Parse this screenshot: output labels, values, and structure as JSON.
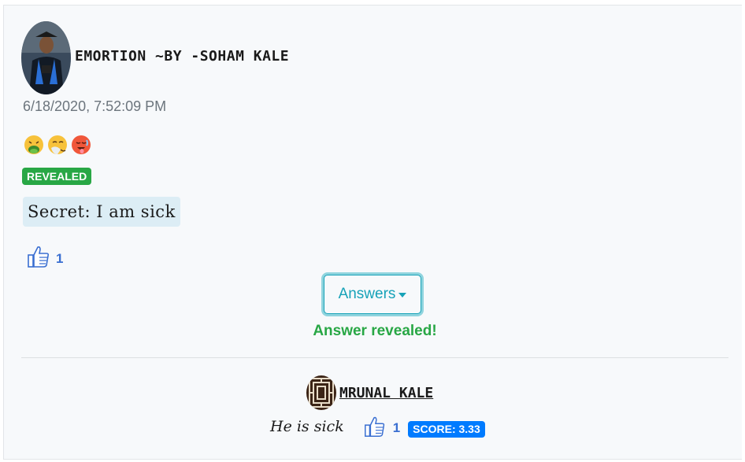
{
  "post": {
    "title": "EMORTION ~BY -SOHAM KALE",
    "timestamp": "6/18/2020, 7:52:09 PM",
    "emojis": [
      "nauseated-face",
      "sneezing-face",
      "hot-face"
    ],
    "status_badge": "REVEALED",
    "secret": "Secret: I am sick",
    "like_count": "1",
    "like_icon": "thumbs-up-icon"
  },
  "answers_button": {
    "label": "Answers"
  },
  "answer_status": "Answer revealed!",
  "answer": {
    "author": "MRUNAL KALE",
    "text": "He is sick",
    "like_count": "1",
    "score": "SCORE: 3.33"
  },
  "colors": {
    "revealed": "#28a745",
    "score": "#007bff",
    "answers_button": "#17a2b8",
    "like": "#3a6fd1"
  }
}
